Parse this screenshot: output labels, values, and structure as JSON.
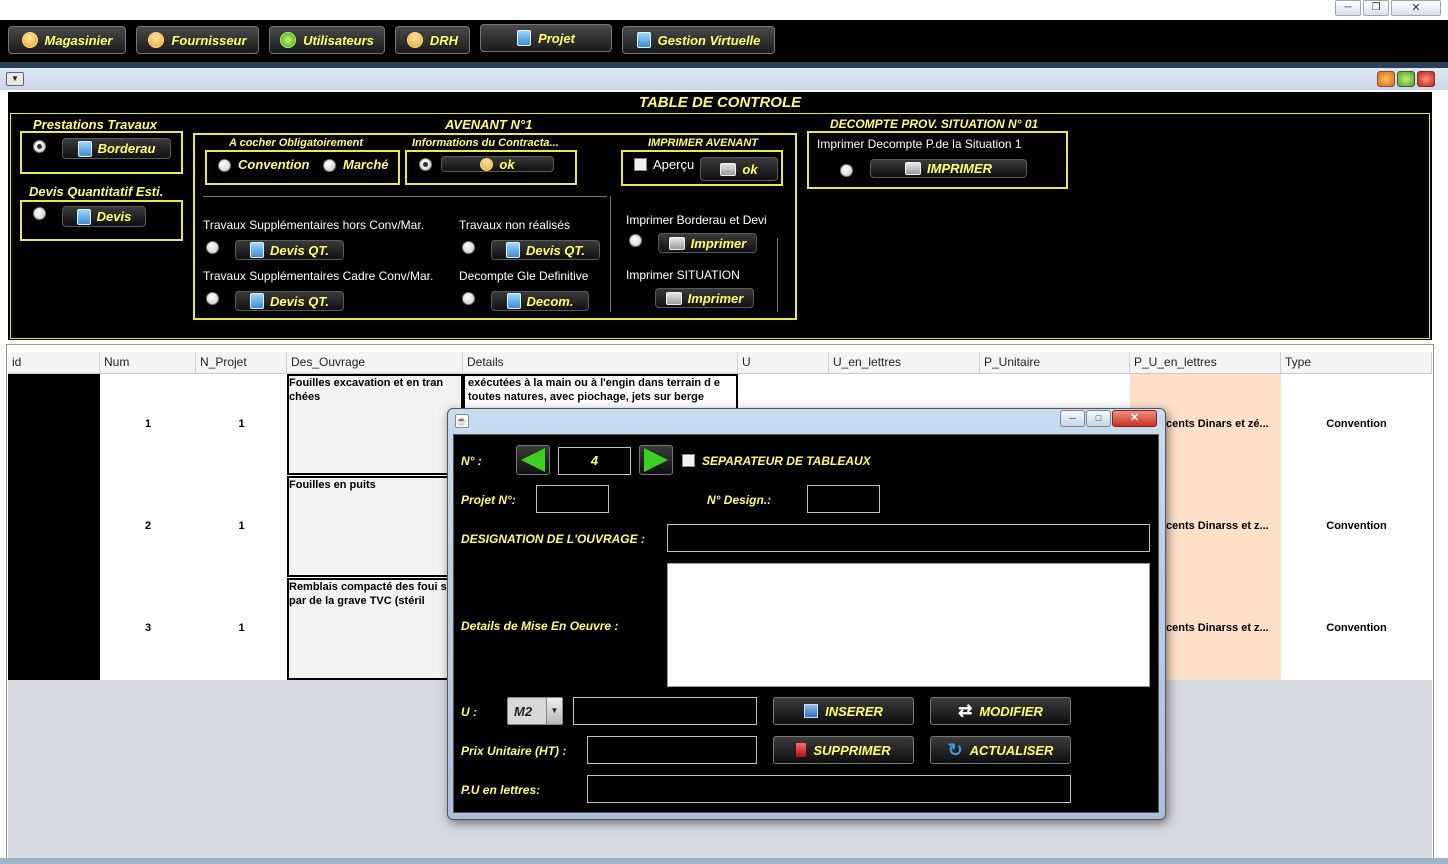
{
  "top_menu": [
    {
      "label": "Magasinier",
      "icon": "user-icon"
    },
    {
      "label": "Fournisseur",
      "icon": "user-icon"
    },
    {
      "label": "Utilisateurs",
      "icon": "shirt-icon"
    },
    {
      "label": "DRH",
      "icon": "user-icon"
    },
    {
      "label": "Projet",
      "icon": "document-icon"
    },
    {
      "label": "Gestion Virtuelle",
      "icon": "document-icon"
    }
  ],
  "panel": {
    "title": "TABLE DE CONTROLE",
    "prestations": {
      "title": "Prestations Travaux",
      "button": "Borderau"
    },
    "devis": {
      "title": "Devis Quantitatif Esti.",
      "button": "Devis"
    },
    "avenant": {
      "title": "AVENANT N°1",
      "cocher_title": "A cocher Obligatoirement",
      "convention": "Convention",
      "marche": "Marché",
      "info_title": "Informations du Contracta...",
      "info_ok": "ok",
      "imprimer_title": "IMPRIMER AVENANT",
      "apercu": "Aperçu",
      "imprimer_ok": "ok",
      "trav_supp_hors": "Travaux Supplémentaires hors Conv/Mar.",
      "trav_supp_hors_btn": "Devis QT.",
      "trav_non_realises": "Travaux non réalisés",
      "trav_non_realises_btn": "Devis QT.",
      "trav_supp_cadre": "Travaux Supplémentaires Cadre  Conv/Mar.",
      "trav_supp_cadre_btn": "Devis QT.",
      "decompte_gle": "Decompte  Gle  Definitive",
      "decompte_gle_btn": "Decom.",
      "imp_bord_devi": "Imprimer Borderau et Devi",
      "imp_bord_devi_btn": "Imprimer",
      "imp_situation": "Imprimer SITUATION",
      "imp_situation_btn": "Imprimer"
    },
    "decompte": {
      "title": "DECOMPTE PROV. SITUATION N° 01",
      "label": "Imprimer Decompte P.de la Situation 1",
      "button": "IMPRIMER"
    }
  },
  "table": {
    "columns": [
      "id",
      "Num",
      "N_Projet",
      "Des_Ouvrage",
      "Details",
      "U",
      "U_en_lettres",
      "P_Unitaire",
      "P_U_en_lettres",
      "Type"
    ],
    "rows": [
      {
        "num": "1",
        "n_projet": "1",
        "des": "Fouilles excavation et en tran chées",
        "details": "exécutées à la main ou à l'engin dans terrain d e toutes natures, avec piochage, jets sur berge",
        "pu_lettres": "cents Dinars et zé...",
        "type": "Convention"
      },
      {
        "num": "2",
        "n_projet": "1",
        "des": "Fouilles en puits",
        "details": "",
        "pu_lettres": "cents Dinarss et z...",
        "type": "Convention"
      },
      {
        "num": "3",
        "n_projet": "1",
        "des": "Remblais compacté des foui s par de la grave TVC (stéril",
        "details": "",
        "pu_lettres": "cents Dinarss et z...",
        "type": "Convention"
      }
    ]
  },
  "dialog": {
    "num_label": "N° :",
    "num_value": "4",
    "separator_label": "SEPARATEUR DE TABLEAUX",
    "projet_label": "Projet N°:",
    "design_label": "N° Design.:",
    "designation_label": "DESIGNATION DE L'OUVRAGE :",
    "details_label": "Details de Mise En Oeuvre :",
    "u_label": "U :",
    "u_value": "M2",
    "prix_label": "Prix Unitaire (HT) :",
    "pu_lettres_label": "P.U en lettres:",
    "inserer": "INSERER",
    "modifier": "MODIFIER",
    "supprimer": "SUPPRIMER",
    "actualiser": "ACTUALISER"
  },
  "colors": {
    "accent_yellow": "#ffff66",
    "box_border": "#e8e84a",
    "panel_bg": "#000000",
    "pu_column": "#fde0c8"
  }
}
